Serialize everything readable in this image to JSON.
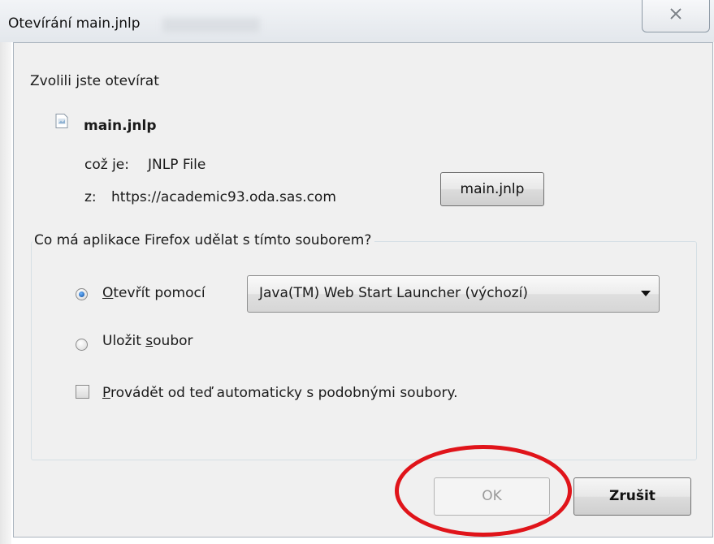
{
  "window": {
    "title": "Otevírání main.jnlp"
  },
  "dialog": {
    "intro": "Zvolili jste otevírat",
    "file_name": "main.jnlp",
    "type_label": "což je:",
    "type_value": "JNLP File",
    "from_label": "z:",
    "from_value": "https://academic93.oda.sas.com",
    "file_button": "main.jnlp"
  },
  "action_group": {
    "legend": "Co má aplikace Firefox udělat s tímto souborem?",
    "open_with": {
      "label_first": "O",
      "label_rest": "tevřít pomocí",
      "checked": true
    },
    "app_select": {
      "value": "Java(TM) Web Start Launcher (výchozí)"
    },
    "save_file": {
      "label_first": "Uložit ",
      "label_underlined": "s",
      "label_rest": "oubor",
      "checked": false
    },
    "auto_checkbox": {
      "label_first": "P",
      "label_rest": "rovádět od teď automaticky s podobnými soubory.",
      "checked": false
    }
  },
  "buttons": {
    "ok": "OK",
    "cancel": "Zrušit"
  },
  "annotation": {
    "color": "#e0141a"
  }
}
